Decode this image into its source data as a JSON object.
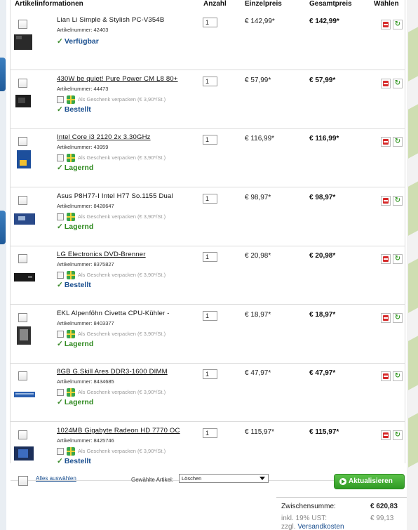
{
  "header": {
    "col_info": "Artikelinformationen",
    "col_qty": "Anzahl",
    "col_unit": "Einzelpreis",
    "col_total": "Gesamtpreis",
    "col_choose": "Wählen"
  },
  "gift_label": "Als Geschenk verpacken (€ 3,90*/St.)",
  "items": [
    {
      "name": "Lian Li Simple & Stylish PC-V354B",
      "art": "Artikelnummer: 42403",
      "qty": "1",
      "unit": "€ 142,99*",
      "total": "€ 142,99*",
      "status": "Verfügbar",
      "status_color": "blue",
      "gift": false,
      "underline": false,
      "thumb": "case"
    },
    {
      "name": "430W be quiet! Pure Power CM L8 80+",
      "art": "Artikelnummer: 44473",
      "qty": "1",
      "unit": "€ 57,99*",
      "total": "€ 57,99*",
      "status": "Bestellt",
      "status_color": "blue",
      "gift": true,
      "underline": true,
      "thumb": "psu"
    },
    {
      "name": "Intel Core i3 2120 2x 3.30GHz",
      "art": "Artikelnummer: 43959",
      "qty": "1",
      "unit": "€ 116,99*",
      "total": "€ 116,99*",
      "status": "Lagernd",
      "status_color": "green",
      "gift": true,
      "underline": true,
      "thumb": "cpu"
    },
    {
      "name": "Asus P8H77-I Intel H77 So.1155 Dual",
      "art": "Artikelnummer: 8428647",
      "qty": "1",
      "unit": "€ 98,97*",
      "total": "€ 98,97*",
      "status": "Lagernd",
      "status_color": "green",
      "gift": true,
      "underline": false,
      "thumb": "board"
    },
    {
      "name": "LG Electronics DVD-Brenner",
      "art": "Artikelnummer: 8375827",
      "qty": "1",
      "unit": "€ 20,98*",
      "total": "€ 20,98*",
      "status": "Bestellt",
      "status_color": "blue",
      "gift": true,
      "underline": true,
      "thumb": "dvd"
    },
    {
      "name": "EKL Alpenföhn Civetta CPU-Kühler -",
      "art": "Artikelnummer: 8403377",
      "qty": "1",
      "unit": "€ 18,97*",
      "total": "€ 18,97*",
      "status": "Lagernd",
      "status_color": "green",
      "gift": true,
      "underline": false,
      "thumb": "cooler"
    },
    {
      "name": "8GB G.Skill Ares DDR3-1600 DIMM",
      "art": "Artikelnummer: 8434685",
      "qty": "1",
      "unit": "€ 47,97*",
      "total": "€ 47,97*",
      "status": "Lagernd",
      "status_color": "green",
      "gift": true,
      "underline": true,
      "thumb": "ram"
    },
    {
      "name": "1024MB Gigabyte Radeon HD 7770 OC",
      "art": "Artikelnummer: 8425746",
      "qty": "1",
      "unit": "€ 115,97*",
      "total": "€ 115,97*",
      "status": "Bestellt",
      "status_color": "blue",
      "gift": true,
      "underline": true,
      "thumb": "gpu"
    }
  ],
  "footer": {
    "select_all": "Alles auswählen",
    "chosen_label": "Gewählte Artikel:",
    "action_value": "Löschen",
    "update_button": "Aktualisieren",
    "subtotal_label": "Zwischensumme:",
    "subtotal_value": "€ 620,83",
    "vat_label": "inkl. 19% UST:",
    "vat_value": "€ 99,13",
    "shipping_prefix": "zzgl.",
    "shipping_link": "Versandkosten"
  },
  "colors": {
    "status_blue": "#1a4f8f",
    "status_green": "#2f8a1f",
    "update_green": "#3aa62c",
    "delete_red": "#d62a2a"
  }
}
